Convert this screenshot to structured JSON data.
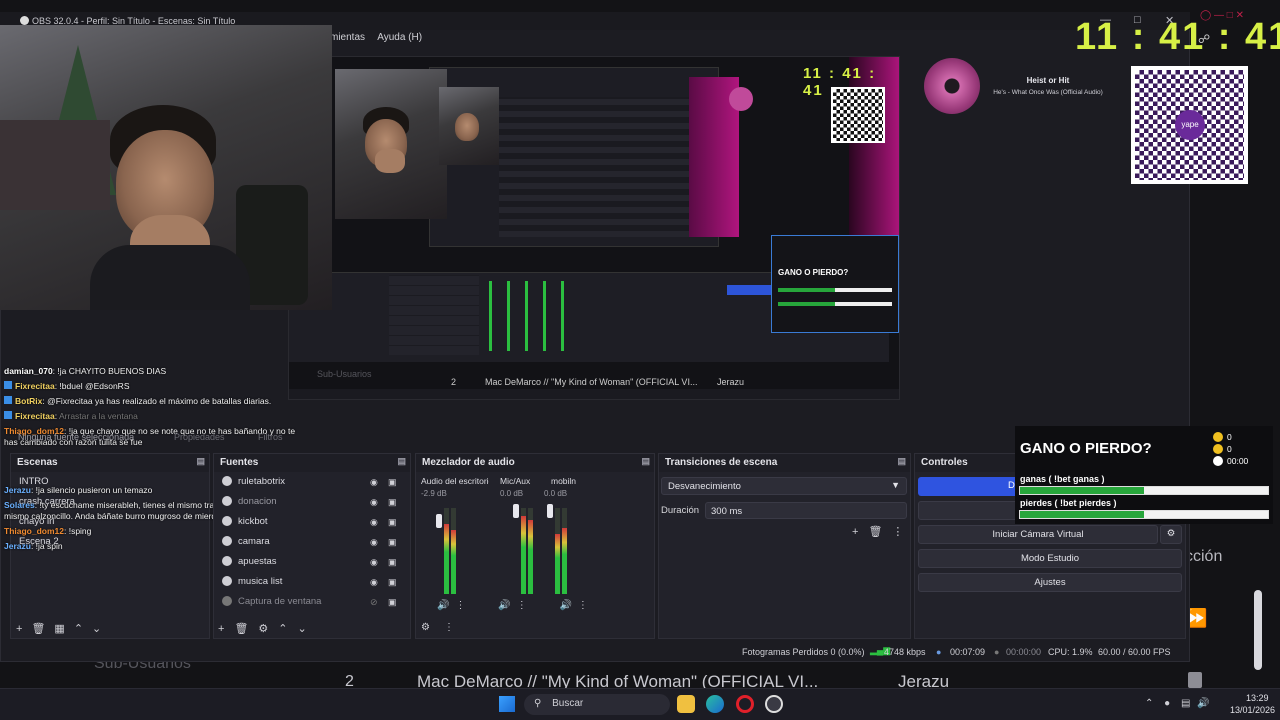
{
  "obs": {
    "title": "OBS 32.0.4 - Perfil: Sin Título - Escenas: Sin Título",
    "menu": [
      "mientas",
      "Ayuda (H)"
    ],
    "scenes_dock": {
      "title": "Escenas",
      "items": [
        "INTRO",
        "crash carrera",
        "chayo irl",
        "Escena 2"
      ]
    },
    "sources_dock": {
      "title": "Fuentes",
      "items": [
        "ruletabotrix",
        "donacion",
        "kickbot",
        "camara",
        "apuestas",
        "musica list",
        "Captura de ventana"
      ]
    },
    "mixer_dock": {
      "title": "Mezclador de audio",
      "channels": [
        {
          "name": "Audio del escritorio",
          "db": "-2.9 dB"
        },
        {
          "name": "Mic/Aux",
          "db": "0.0 dB"
        },
        {
          "name": "mobiln",
          "db": "0.0 dB"
        }
      ],
      "scale": [
        "-5",
        "-10",
        "-15",
        "-20",
        "-25",
        "-30",
        "-35",
        "-40",
        "-45",
        "-50",
        "-55",
        "-60"
      ]
    },
    "transitions_dock": {
      "title": "Transiciones de escena",
      "transition": "Desvanecimiento",
      "duration_label": "Duración",
      "duration": "300 ms"
    },
    "controls_dock": {
      "title": "Controles",
      "virtual_cam": "Iniciar Cámara Virtual",
      "studio_mode": "Modo Estudio",
      "settings": "Ajustes",
      "partial_label": "D",
      "side_partial": "cción"
    },
    "no_source": "Ninguna fuente seleccionada",
    "properties": "Propiedades",
    "filters": "Filtros",
    "status": {
      "frames": "Fotogramas Perdidos 0 (0.0%)",
      "kbps": "4748 kbps",
      "time1": "00:07:09",
      "time2": "00:00:00",
      "cpu": "CPU: 1.9%",
      "fps": "60.00 / 60.00 FPS"
    }
  },
  "overlay": {
    "clock": {
      "h": "11",
      "sep": ":",
      "m": "41",
      "sep2": ":",
      "s": "41"
    },
    "song": {
      "title": "Heist or Hit",
      "artist": "He's - What Once Was (Official Audio)"
    },
    "bet": {
      "title": "GANO O PIERDO?",
      "coins1": "0",
      "coins2": "0",
      "timer": "00:00",
      "win_label": "ganas ( !bet ganas )",
      "lose_label": "pierdes ( !bet pierdes )",
      "win_fraction": 0.5,
      "lose_fraction": 0.5
    },
    "drag_hint": "Arrastar a la ventana",
    "subusers": "Sub-Usuarios"
  },
  "chat": [
    {
      "user": "damian_070",
      "text": ": !ja CHAYITO BUENOS DIAS",
      "color": "#ffffff"
    },
    {
      "user": "Fixrecitaa",
      "text": ": !bduel @EdsonRS",
      "color": "#f0d060"
    },
    {
      "user": "BotRix",
      "text": ": @Fixrecitaa ya has realizado el máximo de batallas diarias.",
      "color": "#f0d060"
    },
    {
      "user": "Fixrecitaa",
      "text": ":",
      "color": "#f0d060"
    },
    {
      "user": "Thiago_dom12",
      "text": ": !ja que chayo que no se note que no te has bañando y no te has cambiado con razón tulita se fue",
      "color": "#f08a30"
    },
    {
      "user": "Jerazu",
      "text": ": !ja silencio pusieron un temazo",
      "color": "#6ab0ff"
    },
    {
      "user": "Solares",
      "text": ": !ty escúchame miserableh, tienes el mismo trapo de ayer y seguro el mismo calzoncillo. Anda báñate burro mugroso de mierdah",
      "color": "#6ab0ff"
    },
    {
      "user": "Thiago_dom12",
      "text": ": !sping",
      "color": "#f08a30"
    },
    {
      "user": "Jerazu",
      "text": ": !ja spin",
      "color": "#6ab0ff"
    }
  ],
  "preview": {
    "track_num": "2",
    "track": "Mac DeMarco // \"My Kind of Woman\" (OFFICIAL VI...",
    "track_user": "Jerazu"
  },
  "background": {
    "track_num": "2",
    "track": "Mac DeMarco // \"My Kind of Woman\" (OFFICIAL VI...",
    "track_user": "Jerazu",
    "subusers": "Sub-Usuarios"
  },
  "taskbar": {
    "search": "Buscar",
    "time": "13:29",
    "date": "13/01/2026"
  },
  "qr": {
    "label": "yape"
  }
}
